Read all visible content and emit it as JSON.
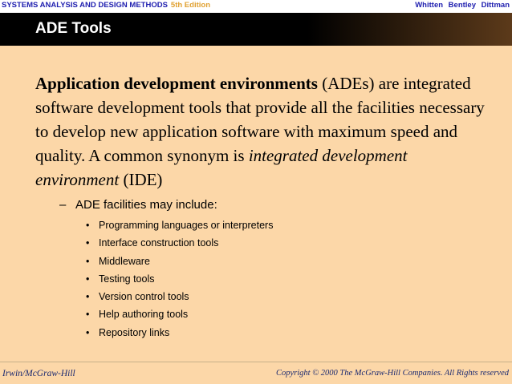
{
  "header": {
    "course": "SYSTEMS ANALYSIS AND DESIGN METHODS",
    "edition": "5th Edition",
    "authors": "Whitten Bentley Dittman"
  },
  "slide": {
    "title": "ADE Tools",
    "paragraph": {
      "bold_term": "Application development environments",
      "after_bold": " (ADEs) are integrated software development tools that provide all the facilities necessary to develop new application software with maximum speed and quality. A common synonym is ",
      "italic_term": "integrated development environment",
      "after_italic": " (IDE)"
    },
    "subheading": {
      "marker": "–",
      "text": "ADE facilities may include:"
    },
    "bullet_marker": "•",
    "bullets": [
      "Programming languages or interpreters",
      "Interface construction tools",
      "Middleware",
      "Testing tools",
      "Version control tools",
      "Help authoring tools",
      "Repository links"
    ]
  },
  "footer": {
    "publisher": "Irwin/McGraw-Hill",
    "copyright": "Copyright © 2000 The McGraw-Hill Companies. All Rights reserved"
  }
}
